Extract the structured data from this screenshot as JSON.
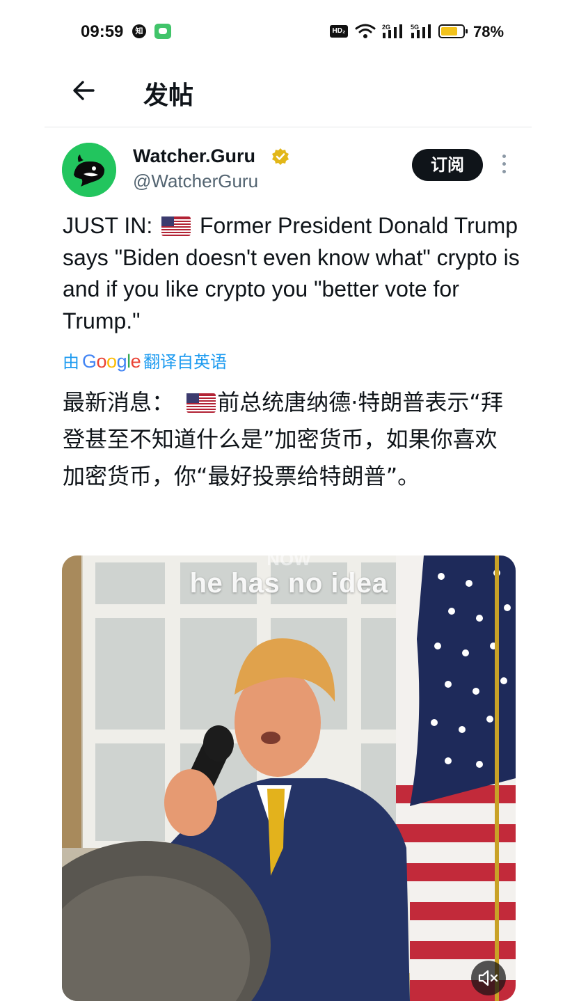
{
  "status_bar": {
    "time": "09:59",
    "app_icons": [
      "zhihu-icon",
      "wechat-icon"
    ],
    "hd_label": "HD₂",
    "signal_1_label": "2G",
    "signal_2_label": "5G",
    "battery_percent": "78%",
    "battery_level": 0.78,
    "battery_color": "#f2c21b"
  },
  "header": {
    "back_icon": "back-arrow-icon",
    "title": "发帖"
  },
  "tweet": {
    "author": {
      "display_name": "Watcher.Guru",
      "handle": "@WatcherGuru",
      "verified_color": "#e2b719",
      "avatar_color": "#22c55e"
    },
    "subscribe_label": "订阅",
    "text_prefix": "JUST IN:",
    "text_body": "Former President Donald Trump says \"Biden doesn't even know what\" crypto is and if you like crypto you \"better vote for Trump.\"",
    "translation": {
      "prefix": "由",
      "provider": "Google",
      "suffix": "翻译自英语"
    },
    "translated_prefix": "最新消息：",
    "translated_body": "前总统唐纳德·特朗普表示“拜登甚至不知道什么是”加密货币，如果你喜欢加密货币，你“最好投票给特朗普”。",
    "media": {
      "caption_faded": "NOW",
      "caption": "he has no idea",
      "mute_icon": "speaker-muted-icon"
    }
  },
  "colors": {
    "text_primary": "#0f1419",
    "text_secondary": "#536471",
    "link": "#1d9bf0",
    "button_dark": "#0f1419"
  }
}
